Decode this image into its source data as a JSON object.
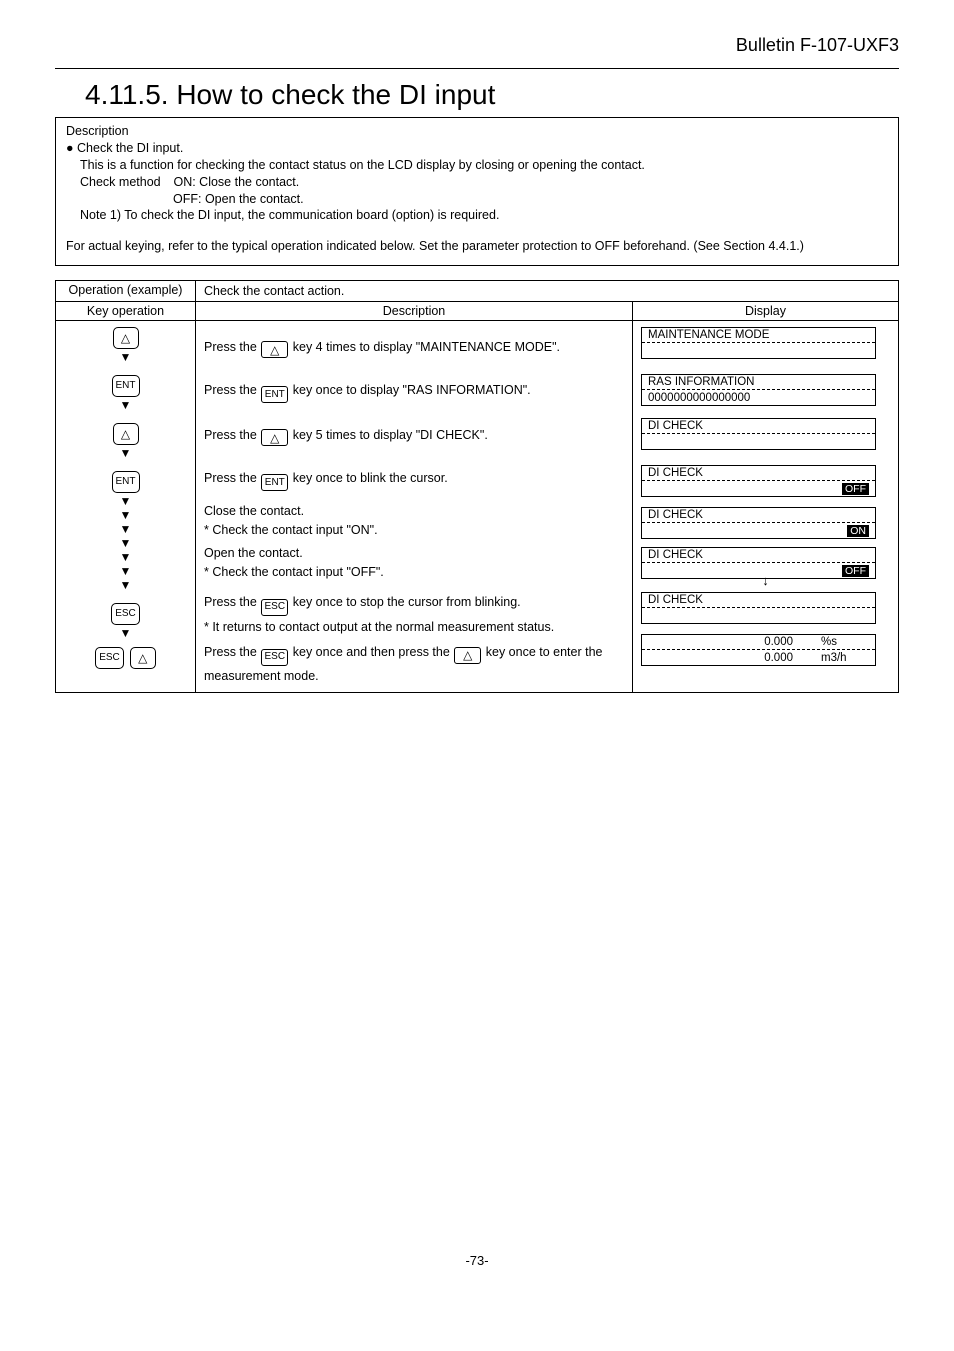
{
  "bulletin": "Bulletin F-107-UXF3",
  "section_title": "4.11.5. How to check the DI input",
  "desc": {
    "heading": "Description",
    "bullet": "● Check the DI input.",
    "line1": "This is a function for checking the contact status on the LCD display by closing or opening the contact.",
    "check_method_label": "Check method",
    "cm_on": "ON: Close the contact.",
    "cm_off": "OFF: Open the contact.",
    "note": "Note 1) To check the DI input, the communication board (option) is required.",
    "last": "For actual keying, refer to the typical operation indicated below. Set the parameter protection to OFF beforehand. (See Section 4.4.1.)"
  },
  "table": {
    "op_example": "Operation (example)",
    "check_action": "Check the contact action.",
    "key_operation": "Key operation",
    "description": "Description",
    "display": "Display"
  },
  "keys": {
    "ent": "ENT",
    "esc": "ESC"
  },
  "steps": {
    "s1": {
      "pre": "Press the ",
      "post": " key 4 times to display \"MAINTENANCE MODE\"."
    },
    "s2": {
      "pre": "Press the ",
      "mid": " key once to display \"RAS INFORMATION\"."
    },
    "s3": {
      "pre": "Press the ",
      "post": " key 5 times to display \"DI CHECK\"."
    },
    "s4": {
      "pre": "Press the ",
      "post": " key once to blink the cursor."
    },
    "s5a": "Close the contact.",
    "s5b": "* Check the contact input \"ON\".",
    "s6a": "Open the contact.",
    "s6b": "* Check the contact input \"OFF\".",
    "s7a": {
      "pre": "Press the ",
      "post": " key once to stop the cursor from blinking."
    },
    "s7b": "* It returns to contact output at the normal measurement status.",
    "s8a": {
      "p1": "Press the ",
      "p2": " key once and then press the ",
      "p3": " key once to enter the"
    },
    "s8b": "measurement mode."
  },
  "lcd": {
    "maint": "MAINTENANCE MODE",
    "ras1": "RAS INFORMATION",
    "ras2": "0000000000000000",
    "dicheck": "DI CHECK",
    "off": "OFF",
    "on": "ON",
    "val1a": "0.000",
    "val1b": "%s",
    "val2a": "0.000",
    "val2b": "m3/h"
  },
  "page": "-73-"
}
